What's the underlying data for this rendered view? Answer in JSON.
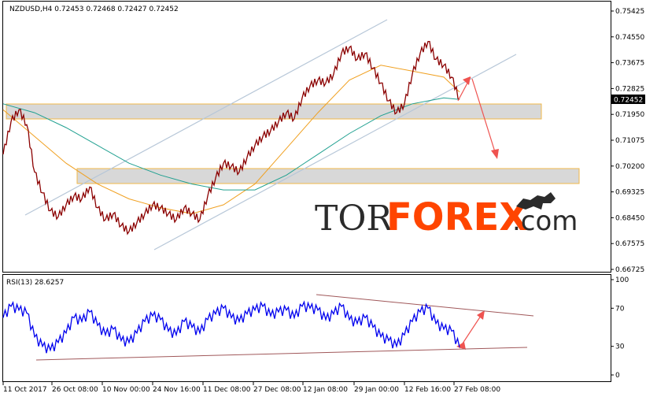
{
  "chart_data": [
    {
      "type": "line",
      "panel": "price",
      "header": {
        "symbol": "NZDUSD,H4",
        "open": "0.72453",
        "high": "0.72468",
        "low": "0.72427",
        "close": "0.72452"
      },
      "current_price_label": "0.72452",
      "y_tick_labels": [
        "0.75425",
        "0.74550",
        "0.73675",
        "0.72825",
        "0.71950",
        "0.71075",
        "0.70200",
        "0.69325",
        "0.68450",
        "0.67575",
        "0.66725"
      ],
      "ylim": [
        0.66725,
        0.75425
      ],
      "x_tick_labels": [
        "11 Oct 2017",
        "26 Oct 08:00",
        "10 Nov 00:00",
        "24 Nov 16:00",
        "11 Dec 08:00",
        "27 Dec 08:00",
        "12 Jan 08:00",
        "29 Jan 00:00",
        "12 Feb 16:00",
        "27 Feb 08:00"
      ],
      "series": [
        {
          "x": [
            0,
            10,
            20,
            30,
            40,
            50,
            60,
            70,
            80,
            90,
            100,
            110,
            120,
            130,
            140,
            150,
            160,
            170,
            180,
            190,
            200,
            210,
            220,
            230,
            240,
            250,
            260,
            270,
            280,
            290,
            300,
            310,
            320,
            330,
            340,
            350,
            360,
            370,
            380,
            390,
            400,
            410,
            420,
            430,
            440,
            450,
            460,
            470,
            480,
            490,
            500,
            510,
            520,
            530,
            540,
            550,
            560,
            570,
            580
          ],
          "values": [
            0.706,
            0.717,
            0.721,
            0.716,
            0.7,
            0.693,
            0.687,
            0.685,
            0.689,
            0.692,
            0.691,
            0.695,
            0.688,
            0.684,
            0.686,
            0.682,
            0.68,
            0.683,
            0.686,
            0.689,
            0.688,
            0.686,
            0.684,
            0.688,
            0.686,
            0.684,
            0.692,
            0.698,
            0.703,
            0.702,
            0.7,
            0.705,
            0.709,
            0.712,
            0.714,
            0.717,
            0.72,
            0.718,
            0.725,
            0.729,
            0.731,
            0.73,
            0.733,
            0.74,
            0.742,
            0.738,
            0.74,
            0.735,
            0.73,
            0.724,
            0.72,
            0.723,
            0.733,
            0.74,
            0.744,
            0.738,
            0.736,
            0.732,
            0.7245
          ]
        },
        {
          "x": [
            0,
            40,
            80,
            120,
            160,
            200,
            240,
            280,
            320,
            360,
            400,
            440,
            480,
            520,
            560,
            580
          ],
          "values": [
            0.721,
            0.712,
            0.703,
            0.696,
            0.691,
            0.688,
            0.686,
            0.689,
            0.696,
            0.708,
            0.72,
            0.731,
            0.736,
            0.734,
            0.732,
            0.727
          ]
        },
        {
          "x": [
            0,
            40,
            80,
            120,
            160,
            200,
            240,
            280,
            320,
            360,
            400,
            440,
            480,
            520,
            560,
            580
          ],
          "values": [
            0.723,
            0.72,
            0.715,
            0.709,
            0.703,
            0.699,
            0.696,
            0.694,
            0.694,
            0.699,
            0.706,
            0.713,
            0.719,
            0.723,
            0.725,
            0.7245
          ]
        }
      ]
    },
    {
      "type": "line",
      "panel": "rsi",
      "header": {
        "name": "RSI(13)",
        "value": "28.6257"
      },
      "y_tick_labels": [
        "100",
        "70",
        "30",
        "0"
      ],
      "ylim": [
        0,
        100
      ],
      "series": [
        {
          "x": [
            0,
            10,
            20,
            30,
            40,
            50,
            60,
            70,
            80,
            90,
            100,
            110,
            120,
            130,
            140,
            150,
            160,
            170,
            180,
            190,
            200,
            210,
            220,
            230,
            240,
            250,
            260,
            270,
            280,
            290,
            300,
            310,
            320,
            330,
            340,
            350,
            360,
            370,
            380,
            390,
            400,
            410,
            420,
            430,
            440,
            450,
            460,
            470,
            480,
            490,
            500,
            510,
            520,
            530,
            540,
            550,
            560,
            570,
            580
          ],
          "values": [
            60,
            72,
            68,
            65,
            40,
            30,
            26,
            34,
            44,
            60,
            56,
            66,
            52,
            42,
            48,
            36,
            34,
            44,
            56,
            62,
            58,
            46,
            42,
            56,
            50,
            44,
            58,
            64,
            70,
            60,
            56,
            64,
            68,
            72,
            62,
            66,
            68,
            60,
            72,
            70,
            68,
            58,
            64,
            72,
            58,
            54,
            60,
            50,
            40,
            36,
            30,
            42,
            56,
            66,
            70,
            54,
            48,
            46,
            29
          ]
        }
      ]
    }
  ]
}
